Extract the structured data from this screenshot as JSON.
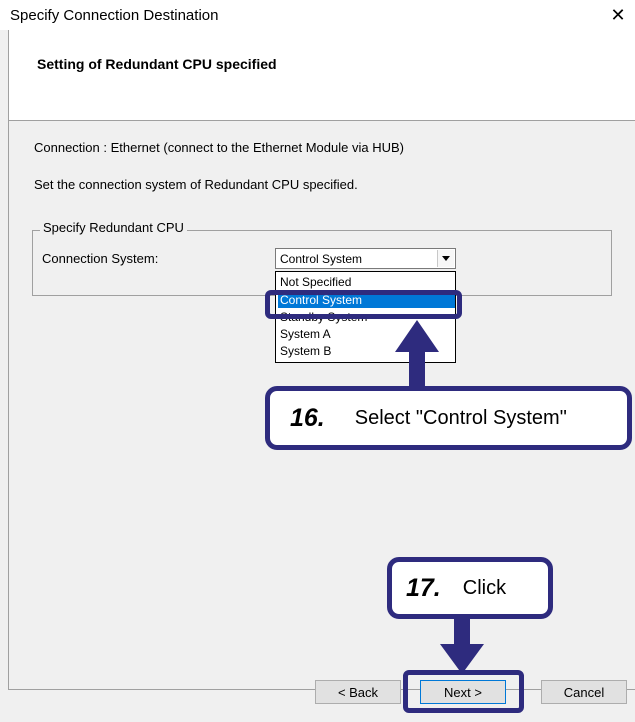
{
  "window": {
    "title": "Specify Connection Destination",
    "close_icon": "close-icon"
  },
  "header": {
    "title": "Setting of Redundant CPU specified"
  },
  "body": {
    "connection_line": "Connection : Ethernet (connect to the Ethernet Module via HUB)",
    "instruction_line": "Set the connection system of Redundant CPU specified."
  },
  "group": {
    "legend": "Specify Redundant CPU",
    "connection_system_label": "Connection System:",
    "selected_value": "Control System",
    "options": [
      "Not Specified",
      "Control System",
      "Standby System",
      "System A",
      "System B"
    ],
    "highlighted_option": "Control System"
  },
  "callouts": {
    "step16": {
      "number": "16.",
      "text": "Select \"Control System\""
    },
    "step17": {
      "number": "17.",
      "text": "Click"
    }
  },
  "buttons": {
    "back": "< Back",
    "next": "Next >",
    "cancel": "Cancel"
  },
  "colors": {
    "annotation": "#2e2b7e",
    "selection": "#0078d7"
  }
}
